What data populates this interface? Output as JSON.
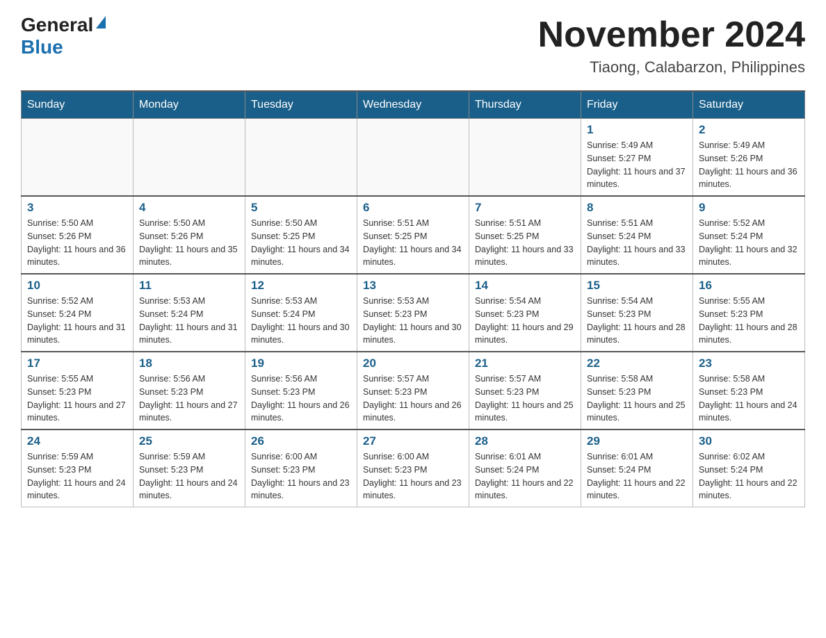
{
  "logo": {
    "general": "General",
    "blue": "Blue"
  },
  "title": {
    "month": "November 2024",
    "location": "Tiaong, Calabarzon, Philippines"
  },
  "weekdays": [
    "Sunday",
    "Monday",
    "Tuesday",
    "Wednesday",
    "Thursday",
    "Friday",
    "Saturday"
  ],
  "weeks": [
    [
      {
        "day": null
      },
      {
        "day": null
      },
      {
        "day": null
      },
      {
        "day": null
      },
      {
        "day": null
      },
      {
        "day": 1,
        "sunrise": "5:49 AM",
        "sunset": "5:27 PM",
        "daylight": "11 hours and 37 minutes."
      },
      {
        "day": 2,
        "sunrise": "5:49 AM",
        "sunset": "5:26 PM",
        "daylight": "11 hours and 36 minutes."
      }
    ],
    [
      {
        "day": 3,
        "sunrise": "5:50 AM",
        "sunset": "5:26 PM",
        "daylight": "11 hours and 36 minutes."
      },
      {
        "day": 4,
        "sunrise": "5:50 AM",
        "sunset": "5:26 PM",
        "daylight": "11 hours and 35 minutes."
      },
      {
        "day": 5,
        "sunrise": "5:50 AM",
        "sunset": "5:25 PM",
        "daylight": "11 hours and 34 minutes."
      },
      {
        "day": 6,
        "sunrise": "5:51 AM",
        "sunset": "5:25 PM",
        "daylight": "11 hours and 34 minutes."
      },
      {
        "day": 7,
        "sunrise": "5:51 AM",
        "sunset": "5:25 PM",
        "daylight": "11 hours and 33 minutes."
      },
      {
        "day": 8,
        "sunrise": "5:51 AM",
        "sunset": "5:24 PM",
        "daylight": "11 hours and 33 minutes."
      },
      {
        "day": 9,
        "sunrise": "5:52 AM",
        "sunset": "5:24 PM",
        "daylight": "11 hours and 32 minutes."
      }
    ],
    [
      {
        "day": 10,
        "sunrise": "5:52 AM",
        "sunset": "5:24 PM",
        "daylight": "11 hours and 31 minutes."
      },
      {
        "day": 11,
        "sunrise": "5:53 AM",
        "sunset": "5:24 PM",
        "daylight": "11 hours and 31 minutes."
      },
      {
        "day": 12,
        "sunrise": "5:53 AM",
        "sunset": "5:24 PM",
        "daylight": "11 hours and 30 minutes."
      },
      {
        "day": 13,
        "sunrise": "5:53 AM",
        "sunset": "5:23 PM",
        "daylight": "11 hours and 30 minutes."
      },
      {
        "day": 14,
        "sunrise": "5:54 AM",
        "sunset": "5:23 PM",
        "daylight": "11 hours and 29 minutes."
      },
      {
        "day": 15,
        "sunrise": "5:54 AM",
        "sunset": "5:23 PM",
        "daylight": "11 hours and 28 minutes."
      },
      {
        "day": 16,
        "sunrise": "5:55 AM",
        "sunset": "5:23 PM",
        "daylight": "11 hours and 28 minutes."
      }
    ],
    [
      {
        "day": 17,
        "sunrise": "5:55 AM",
        "sunset": "5:23 PM",
        "daylight": "11 hours and 27 minutes."
      },
      {
        "day": 18,
        "sunrise": "5:56 AM",
        "sunset": "5:23 PM",
        "daylight": "11 hours and 27 minutes."
      },
      {
        "day": 19,
        "sunrise": "5:56 AM",
        "sunset": "5:23 PM",
        "daylight": "11 hours and 26 minutes."
      },
      {
        "day": 20,
        "sunrise": "5:57 AM",
        "sunset": "5:23 PM",
        "daylight": "11 hours and 26 minutes."
      },
      {
        "day": 21,
        "sunrise": "5:57 AM",
        "sunset": "5:23 PM",
        "daylight": "11 hours and 25 minutes."
      },
      {
        "day": 22,
        "sunrise": "5:58 AM",
        "sunset": "5:23 PM",
        "daylight": "11 hours and 25 minutes."
      },
      {
        "day": 23,
        "sunrise": "5:58 AM",
        "sunset": "5:23 PM",
        "daylight": "11 hours and 24 minutes."
      }
    ],
    [
      {
        "day": 24,
        "sunrise": "5:59 AM",
        "sunset": "5:23 PM",
        "daylight": "11 hours and 24 minutes."
      },
      {
        "day": 25,
        "sunrise": "5:59 AM",
        "sunset": "5:23 PM",
        "daylight": "11 hours and 24 minutes."
      },
      {
        "day": 26,
        "sunrise": "6:00 AM",
        "sunset": "5:23 PM",
        "daylight": "11 hours and 23 minutes."
      },
      {
        "day": 27,
        "sunrise": "6:00 AM",
        "sunset": "5:23 PM",
        "daylight": "11 hours and 23 minutes."
      },
      {
        "day": 28,
        "sunrise": "6:01 AM",
        "sunset": "5:24 PM",
        "daylight": "11 hours and 22 minutes."
      },
      {
        "day": 29,
        "sunrise": "6:01 AM",
        "sunset": "5:24 PM",
        "daylight": "11 hours and 22 minutes."
      },
      {
        "day": 30,
        "sunrise": "6:02 AM",
        "sunset": "5:24 PM",
        "daylight": "11 hours and 22 minutes."
      }
    ]
  ]
}
